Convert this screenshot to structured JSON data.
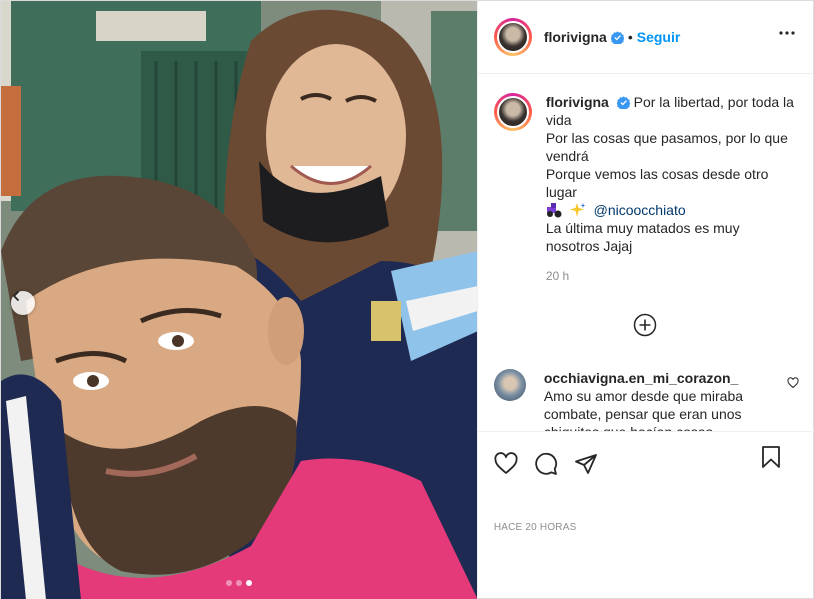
{
  "header": {
    "username": "florivigna",
    "dot": "•",
    "follow_label": "Seguir"
  },
  "caption": {
    "username": "florivigna",
    "lines": [
      "Por la libertad, por toda la vida",
      "Por las cosas que pasamos, por lo que vendrá",
      "Porque vemos las cosas desde otro lugar"
    ],
    "mention": "@nicoocchiato",
    "last_line": "La última muy matados es muy nosotros Jajaj",
    "time": "20 h"
  },
  "comment": {
    "username": "occhiavigna.en_mi_corazon_",
    "text": "Amo su amor desde que miraba combate, pensar que eran unos chiquitos que hacían cosas"
  },
  "footer": {
    "time_ago": "HACE 20 HORAS"
  },
  "carousel": {
    "count": 3,
    "active_index": 2
  },
  "colors": {
    "accent": "#0095f6",
    "verified": "#3897f0",
    "mention": "#00376b",
    "muted": "#8e8e8e"
  },
  "icons": {
    "more": "more-horizontal-icon",
    "like": "heart-icon",
    "comment": "comment-icon",
    "share": "paper-plane-icon",
    "save": "bookmark-icon",
    "load_more": "plus-circle-icon",
    "prev": "chevron-left-icon"
  }
}
